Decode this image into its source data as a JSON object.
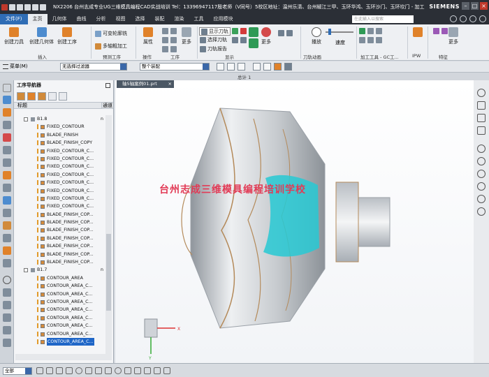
{
  "window": {
    "title": "NX2206 台州志成专业UG三维模具编程CAD实战培训  Tel：13396947117殷老师（V同号）5校区地址：温州乐清、台州椒江三甲、玉环华鸿、玉环沙门、玉环坎门 - 加工",
    "brand": "SIEMENS"
  },
  "menu": {
    "file_label": "文件(F)",
    "tabs": [
      "主页",
      "几何体",
      "曲线",
      "分析",
      "视图",
      "选择",
      "装配",
      "渲染",
      "工具",
      "应用模块"
    ],
    "active_tab": "主页",
    "search_placeholder": "在此输入以搜索"
  },
  "ribbon": {
    "buttons": {
      "create_tool": "创建刀具",
      "create_geometry": "创建几何体",
      "create_operation": "创建工序",
      "variable_contour": "可变轮廓铣",
      "multi_axis": "多轴粗加工",
      "properties": "属性",
      "more": "更多",
      "show_toolpath": "显示刀轨",
      "select_toolpath": "选择刀轨",
      "toolpath_report": "刀轨报告",
      "playback": "播放",
      "speed": "速度"
    },
    "groups": [
      "插入",
      "预测工序",
      "操作",
      "工序",
      "显示",
      "刀轨动画",
      "加工工具 - GC工...",
      "IPW",
      "特征"
    ]
  },
  "toolbar2": {
    "menu_label": "菜单(M)",
    "filter_value": "无选择过滤器",
    "assembly_value": "整个装配",
    "view_title": "总计 1"
  },
  "navigator": {
    "title": "工序导航器",
    "col_name": "标题",
    "col_swap": "通道",
    "rows": [
      {
        "type": "group",
        "label": "B1.8",
        "flag": "n"
      },
      {
        "type": "op",
        "label": "FIXED_CONTOUR"
      },
      {
        "type": "op",
        "label": "BLADE_FINISH"
      },
      {
        "type": "op",
        "label": "BLADE_FINISH_COPY"
      },
      {
        "type": "op",
        "label": "FIXED_CONTOUR_C..."
      },
      {
        "type": "op",
        "label": "FIXED_CONTOUR_C..."
      },
      {
        "type": "op",
        "label": "FIXED_CONTOUR_C..."
      },
      {
        "type": "op",
        "label": "FIXED_CONTOUR_C..."
      },
      {
        "type": "op",
        "label": "FIXED_CONTOUR_C..."
      },
      {
        "type": "op",
        "label": "FIXED_CONTOUR_C..."
      },
      {
        "type": "op",
        "label": "FIXED_CONTOUR_C..."
      },
      {
        "type": "op",
        "label": "FIXED_CONTOUR_C..."
      },
      {
        "type": "op",
        "label": "BLADE_FINISH_COP..."
      },
      {
        "type": "op",
        "label": "BLADE_FINISH_COP..."
      },
      {
        "type": "op",
        "label": "BLADE_FINISH_COP..."
      },
      {
        "type": "op",
        "label": "BLADE_FINISH_COP..."
      },
      {
        "type": "op",
        "label": "BLADE_FINISH_COP..."
      },
      {
        "type": "op",
        "label": "BLADE_FINISH_COP..."
      },
      {
        "type": "op",
        "label": "BLADE_FINISH_COP..."
      },
      {
        "type": "group",
        "label": "B1.7",
        "flag": "n"
      },
      {
        "type": "op",
        "label": "CONTOUR_AREA"
      },
      {
        "type": "op",
        "label": "CONTOUR_AREA_C..."
      },
      {
        "type": "op",
        "label": "CONTOUR_AREA_C..."
      },
      {
        "type": "op",
        "label": "CONTOUR_AREA_C..."
      },
      {
        "type": "op",
        "label": "CONTOUR_AREA_C..."
      },
      {
        "type": "op",
        "label": "CONTOUR_AREA_C..."
      },
      {
        "type": "op",
        "label": "CONTOUR_AREA_C..."
      },
      {
        "type": "op",
        "label": "CONTOUR_AREA_C..."
      },
      {
        "type": "op",
        "label": "CONTOUR_AREA_C...",
        "selected": true
      }
    ]
  },
  "viewport": {
    "file_tab": "轴5轴案例01.prt",
    "watermark": "台州志成三维模具编程培训学校",
    "triad_x": "X",
    "triad_y": "Y"
  },
  "status": {
    "scope_value": "全部"
  },
  "colors": {
    "accent": "#2f6db5",
    "toolpath": "#27c9d3",
    "watermark": "#e23a55",
    "selected_row": "#1f66c7"
  }
}
